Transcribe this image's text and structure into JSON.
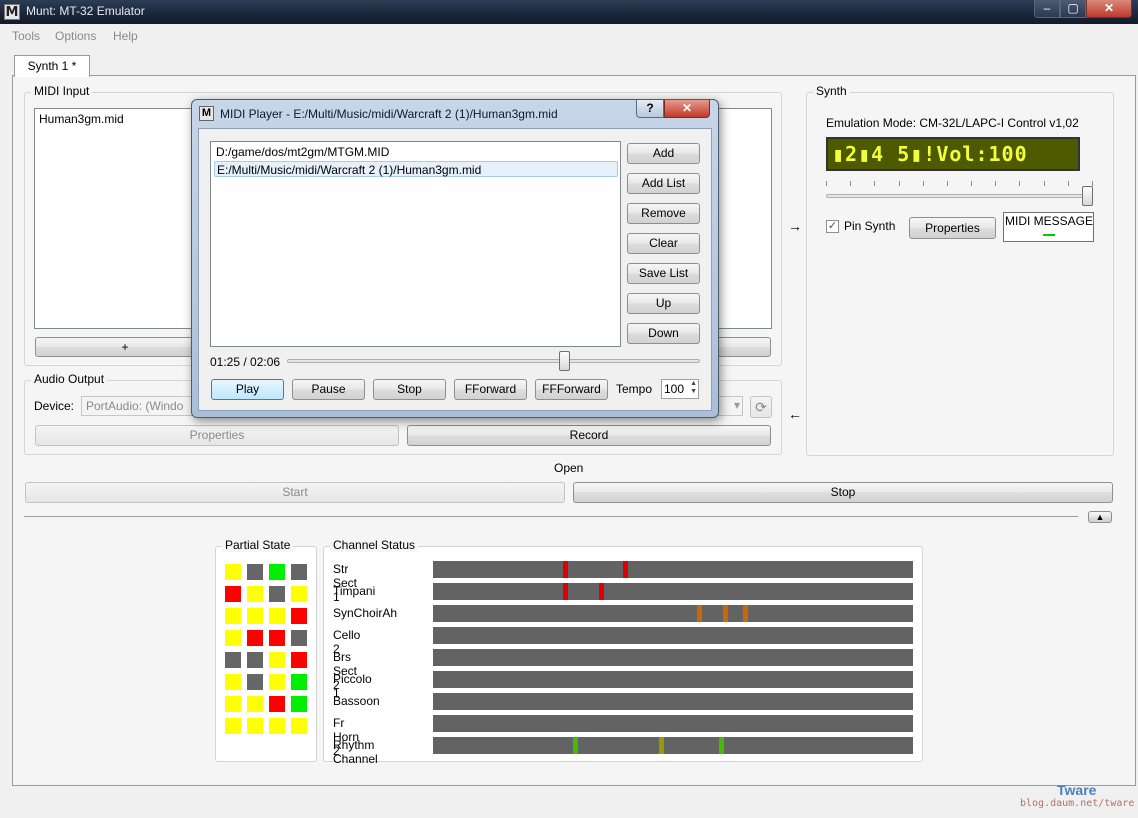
{
  "window": {
    "title": "Munt: MT-32 Emulator",
    "icon": "munt-logo-icon"
  },
  "menu": [
    "Tools",
    "Options",
    "Help"
  ],
  "tabs": [
    {
      "label": "Synth 1 *"
    }
  ],
  "midi_input": {
    "title": "MIDI Input",
    "items": [
      "Human3gm.mid"
    ],
    "add_button": "+"
  },
  "audio_output": {
    "title": "Audio Output",
    "device_label": "Device:",
    "device_value": "PortAudio: (Windo",
    "properties_button": "Properties",
    "record_button": "Record"
  },
  "synth": {
    "title": "Synth",
    "emulation_mode": "Emulation Mode: CM-32L/LAPC-I Control v1,02",
    "lcd_text": "▮2▮4 5▮!Vol:100",
    "pin_synth_label": "Pin Synth",
    "pin_synth_checked": true,
    "properties_button": "Properties",
    "midi_message_label": "MIDI MESSAGE",
    "arrow_in": "→",
    "arrow_out": "←"
  },
  "controls": {
    "open_label": "Open",
    "start_button": "Start",
    "stop_button": "Stop",
    "collapse_icon": "triangle-up-icon"
  },
  "partial_state": {
    "title": "Partial State",
    "colors": {
      "yellow": "#ffff00",
      "gray": "#666666",
      "green": "#00ee00",
      "red": "#ff0000"
    },
    "grid": [
      [
        "yellow",
        "gray",
        "green",
        "gray"
      ],
      [
        "red",
        "yellow",
        "gray",
        "yellow"
      ],
      [
        "yellow",
        "yellow",
        "yellow",
        "red"
      ],
      [
        "yellow",
        "red",
        "red",
        "gray"
      ],
      [
        "gray",
        "gray",
        "yellow",
        "red"
      ],
      [
        "yellow",
        "gray",
        "yellow",
        "green"
      ],
      [
        "yellow",
        "yellow",
        "red",
        "green"
      ],
      [
        "yellow",
        "yellow",
        "yellow",
        "yellow"
      ]
    ]
  },
  "channel_status": {
    "title": "Channel Status",
    "channels": [
      {
        "name": "Str Sect 1",
        "marks": [
          {
            "pos": 0.27,
            "color": "#dd0000"
          },
          {
            "pos": 0.395,
            "color": "#dd0000"
          }
        ]
      },
      {
        "name": "Timpani",
        "marks": [
          {
            "pos": 0.27,
            "color": "#dd0000"
          },
          {
            "pos": 0.345,
            "color": "#dd0000"
          }
        ]
      },
      {
        "name": "SynChoirAh",
        "marks": [
          {
            "pos": 0.55,
            "color": "#cc6600"
          },
          {
            "pos": 0.605,
            "color": "#cc6600"
          },
          {
            "pos": 0.645,
            "color": "#cc6600"
          }
        ]
      },
      {
        "name": "Cello 2",
        "marks": []
      },
      {
        "name": "Brs Sect 2",
        "marks": []
      },
      {
        "name": "Piccolo 1",
        "marks": []
      },
      {
        "name": "Bassoon",
        "marks": []
      },
      {
        "name": "Fr Horn 2",
        "marks": []
      },
      {
        "name": "Rhythm Channel",
        "marks": [
          {
            "pos": 0.292,
            "color": "#44bb00"
          },
          {
            "pos": 0.47,
            "color": "#999900"
          },
          {
            "pos": 0.595,
            "color": "#44bb00"
          }
        ]
      }
    ]
  },
  "midi_player": {
    "title": "MIDI Player - E:/Multi/Music/midi/Warcraft 2 (1)/Human3gm.mid",
    "help_button": "?",
    "close_button": "✕",
    "playlist": [
      "D:/game/dos/mt2gm/MTGM.MID",
      "E:/Multi/Music/midi/Warcraft 2 (1)/Human3gm.mid"
    ],
    "selected_index": 1,
    "side_buttons": [
      "Add",
      "Add List",
      "Remove",
      "Clear",
      "Save List",
      "Up",
      "Down"
    ],
    "position_text": "01:25 / 02:06",
    "progress": 0.67,
    "transport_buttons": [
      "Play",
      "Pause",
      "Stop",
      "FForward",
      "FFForward"
    ],
    "tempo_label": "Tempo",
    "tempo_value": "100"
  },
  "watermark": {
    "brand": "Tware",
    "url": "blog.daum.net/tware"
  }
}
